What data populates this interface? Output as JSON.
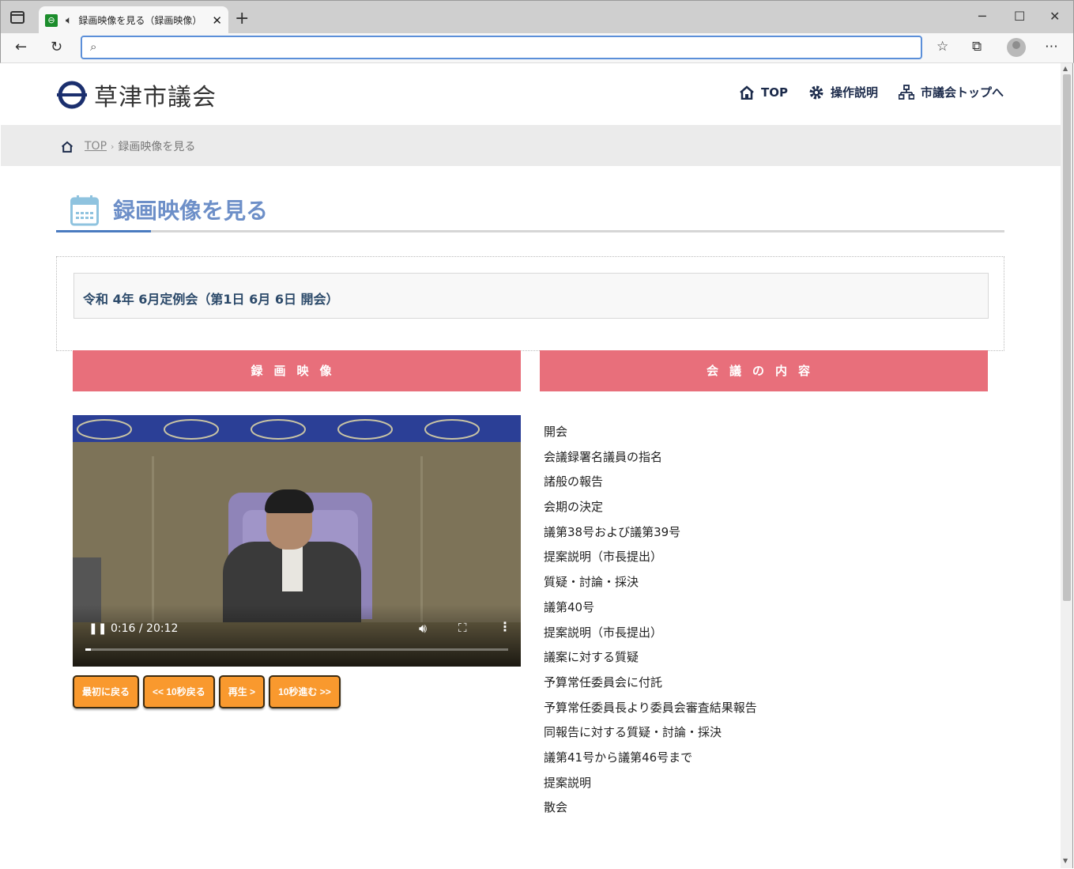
{
  "browser": {
    "tab_title": "録画映像を見る（録画映像）",
    "favicon_glyph": "⊖",
    "url": ""
  },
  "site": {
    "name": "草津市議会",
    "nav": [
      {
        "label": "TOP",
        "icon": "home-icon"
      },
      {
        "label": "操作説明",
        "icon": "gear-icon"
      },
      {
        "label": "市議会トップへ",
        "icon": "sitemap-icon"
      }
    ]
  },
  "breadcrumb": {
    "home": "TOP",
    "current": "録画映像を見る"
  },
  "page": {
    "title": "録画映像を見る",
    "session": "令和 4年 6月定例会（第1日 6月 6日 開会）"
  },
  "sections": {
    "video_heading": "録画映像",
    "agenda_heading": "会議の内容"
  },
  "video": {
    "time": "0:16 / 20:12",
    "progress": 0.013
  },
  "controls": [
    "最初に戻る",
    "<< 10秒戻る",
    "再生 >",
    "10秒進む >>"
  ],
  "agenda": [
    "開会",
    "会議録署名議員の指名",
    "諸般の報告",
    "会期の決定",
    "議第38号および議第39号",
    "提案説明（市長提出）",
    "質疑・討論・採決",
    "議第40号",
    "提案説明（市長提出）",
    "議案に対する質疑",
    "予算常任委員会に付託",
    "予算常任委員長より委員会審査結果報告",
    "同報告に対する質疑・討論・採決",
    "議第41号から議第46号まで",
    "提案説明",
    "散会"
  ],
  "colors": {
    "section_header": "#e86f7b",
    "control_button": "#f9992e",
    "title_text": "#6d8fc8",
    "title_accent": "#4a7bc0",
    "nav_text": "#1b2a4a"
  }
}
